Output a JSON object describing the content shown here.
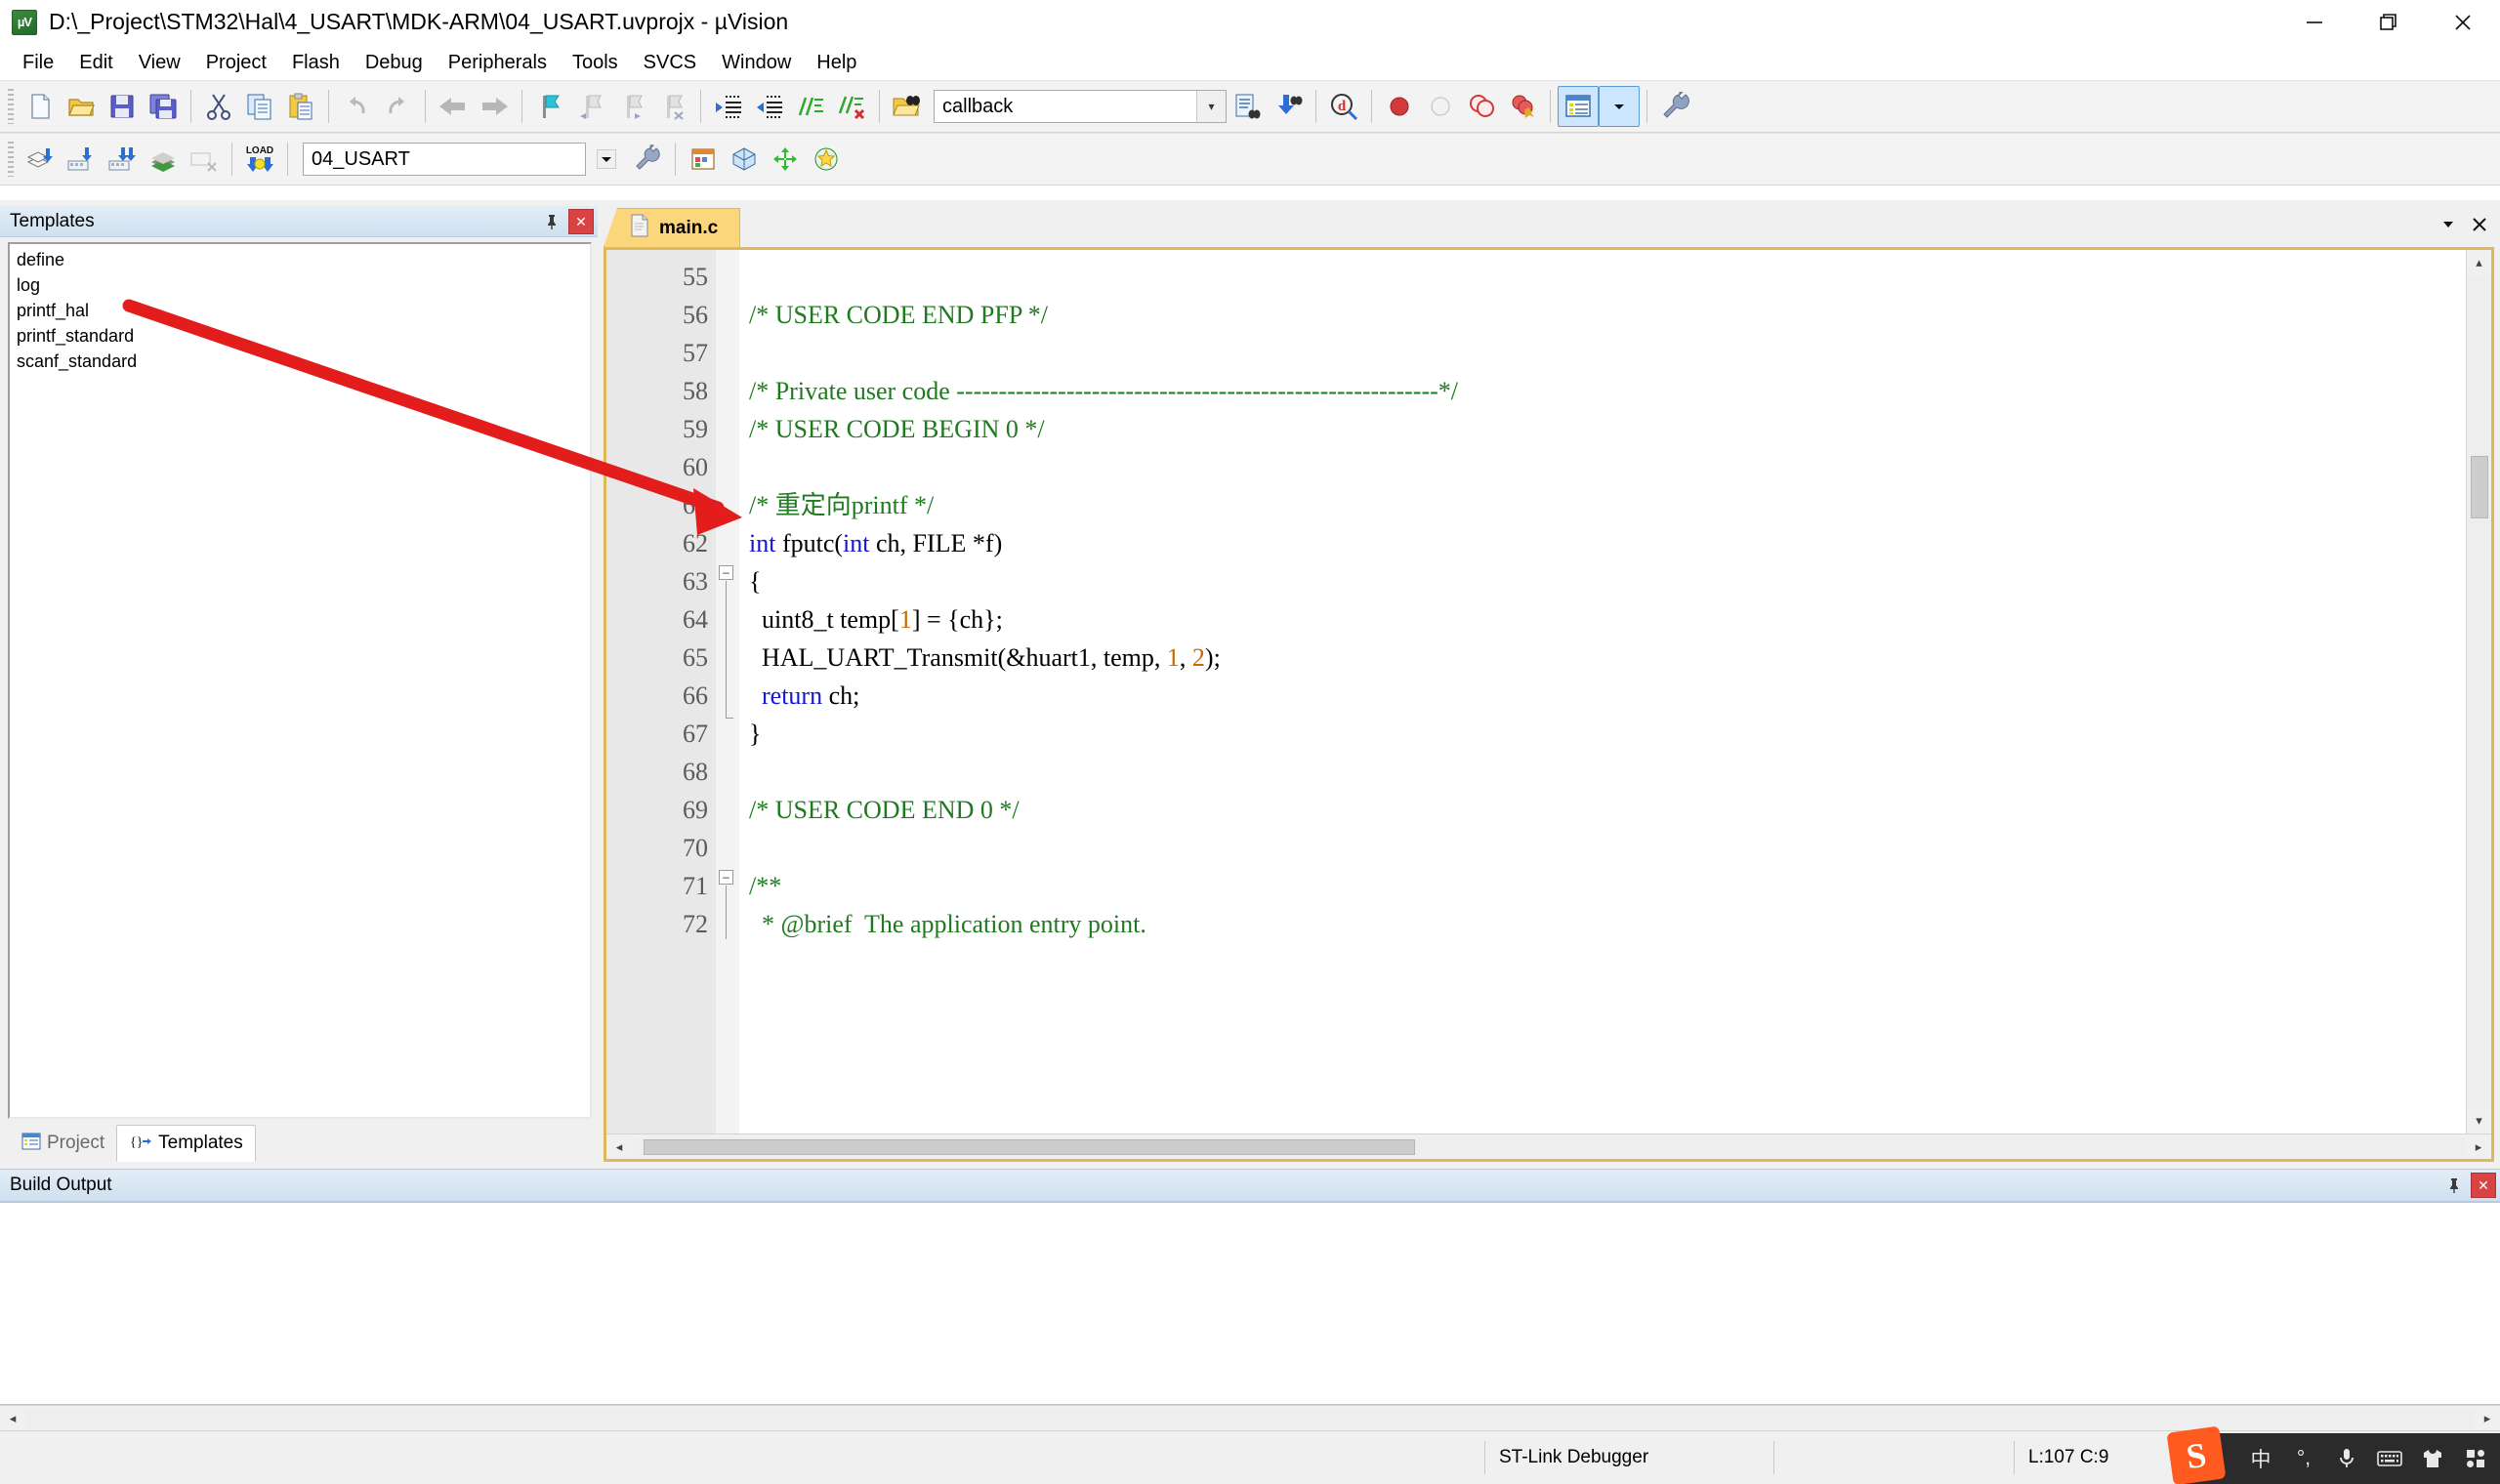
{
  "window": {
    "title": "D:\\_Project\\STM32\\Hal\\4_USART\\MDK-ARM\\04_USART.uvprojx - µVision",
    "app_icon": "uvision-icon",
    "controls": {
      "minimize": "minimize-icon",
      "maximize": "maximize-icon",
      "close": "close-icon"
    }
  },
  "menu": {
    "items": [
      {
        "label": "File"
      },
      {
        "label": "Edit"
      },
      {
        "label": "View"
      },
      {
        "label": "Project"
      },
      {
        "label": "Flash"
      },
      {
        "label": "Debug"
      },
      {
        "label": "Peripherals"
      },
      {
        "label": "Tools"
      },
      {
        "label": "SVCS"
      },
      {
        "label": "Window"
      },
      {
        "label": "Help"
      }
    ]
  },
  "toolbar_main": {
    "search_value": "callback",
    "search_placeholder": "",
    "buttons": [
      {
        "name": "new-file-icon"
      },
      {
        "name": "open-file-icon"
      },
      {
        "name": "save-icon"
      },
      {
        "name": "save-all-icon"
      },
      {
        "name": "cut-icon"
      },
      {
        "name": "copy-icon"
      },
      {
        "name": "paste-icon"
      },
      {
        "name": "undo-icon"
      },
      {
        "name": "redo-icon"
      },
      {
        "name": "navigate-back-icon"
      },
      {
        "name": "navigate-forward-icon"
      },
      {
        "name": "bookmark-toggle-icon"
      },
      {
        "name": "bookmark-prev-icon"
      },
      {
        "name": "bookmark-next-icon"
      },
      {
        "name": "bookmark-clear-icon"
      },
      {
        "name": "indent-right-icon"
      },
      {
        "name": "indent-left-icon"
      },
      {
        "name": "comment-icon"
      },
      {
        "name": "uncomment-icon"
      },
      {
        "name": "find-in-files-icon"
      }
    ]
  },
  "toolbar_build": {
    "project_value": "04_USART",
    "buttons": [
      {
        "name": "translate-icon"
      },
      {
        "name": "build-icon"
      },
      {
        "name": "rebuild-icon"
      },
      {
        "name": "batch-build-icon"
      },
      {
        "name": "stop-build-icon"
      },
      {
        "name": "download-load-icon"
      },
      {
        "name": "target-options-icon"
      },
      {
        "name": "manage-components-icon"
      },
      {
        "name": "pack-installer-icon"
      },
      {
        "name": "manage-run-time-icon"
      },
      {
        "name": "configuration-wizard-icon"
      }
    ]
  },
  "templates_panel": {
    "title": "Templates",
    "pin_icon": "pin-icon",
    "close_icon": "close-icon",
    "items": [
      {
        "label": "define"
      },
      {
        "label": "log"
      },
      {
        "label": "printf_hal"
      },
      {
        "label": "printf_standard"
      },
      {
        "label": "scanf_standard"
      }
    ],
    "tabs": [
      {
        "label": "Project",
        "icon": "project-icon",
        "active": false
      },
      {
        "label": "Templates",
        "icon": "templates-icon",
        "active": true
      }
    ]
  },
  "editor": {
    "tabs": [
      {
        "label": "main.c",
        "icon": "c-file-icon",
        "active": true
      }
    ],
    "tab_menu_icon": "chevron-down-icon",
    "tab_close_icon": "close-icon",
    "first_line": 55,
    "lines": [
      {
        "n": 55,
        "fold": "",
        "tokens": []
      },
      {
        "n": 56,
        "fold": "",
        "tokens": [
          {
            "t": "/* USER CODE END PFP */",
            "c": "cmt"
          }
        ]
      },
      {
        "n": 57,
        "fold": "",
        "tokens": []
      },
      {
        "n": 58,
        "fold": "",
        "tokens": [
          {
            "t": "/* Private user code ---------------------------------------------------------*/",
            "c": "cmt"
          }
        ]
      },
      {
        "n": 59,
        "fold": "",
        "tokens": [
          {
            "t": "/* USER CODE BEGIN 0 */",
            "c": "cmt"
          }
        ]
      },
      {
        "n": 60,
        "fold": "",
        "tokens": []
      },
      {
        "n": 61,
        "fold": "",
        "tokens": [
          {
            "t": "/* 重定向printf */",
            "c": "cmt"
          }
        ]
      },
      {
        "n": 62,
        "fold": "",
        "tokens": [
          {
            "t": "int",
            "c": "kw"
          },
          {
            "t": " fputc(",
            "c": ""
          },
          {
            "t": "int",
            "c": "kw"
          },
          {
            "t": " ch, FILE *f)",
            "c": ""
          }
        ]
      },
      {
        "n": 63,
        "fold": "start",
        "tokens": [
          {
            "t": "{",
            "c": ""
          }
        ]
      },
      {
        "n": 64,
        "fold": "mid",
        "tokens": [
          {
            "t": "  uint8_t temp[",
            "c": ""
          },
          {
            "t": "1",
            "c": "num"
          },
          {
            "t": "] = {ch};",
            "c": ""
          }
        ]
      },
      {
        "n": 65,
        "fold": "mid",
        "tokens": [
          {
            "t": "  HAL_UART_Transmit(&huart1, temp, ",
            "c": ""
          },
          {
            "t": "1",
            "c": "num"
          },
          {
            "t": ", ",
            "c": ""
          },
          {
            "t": "2",
            "c": "num"
          },
          {
            "t": ");",
            "c": ""
          }
        ]
      },
      {
        "n": 66,
        "fold": "mid",
        "tokens": [
          {
            "t": "  ",
            "c": ""
          },
          {
            "t": "return",
            "c": "kw"
          },
          {
            "t": " ch;",
            "c": ""
          }
        ]
      },
      {
        "n": 67,
        "fold": "end",
        "tokens": [
          {
            "t": "}",
            "c": ""
          }
        ]
      },
      {
        "n": 68,
        "fold": "",
        "tokens": []
      },
      {
        "n": 69,
        "fold": "",
        "tokens": [
          {
            "t": "/* USER CODE END 0 */",
            "c": "cmt"
          }
        ]
      },
      {
        "n": 70,
        "fold": "",
        "tokens": []
      },
      {
        "n": 71,
        "fold": "start",
        "tokens": [
          {
            "t": "/**",
            "c": "cmt"
          }
        ]
      },
      {
        "n": 72,
        "fold": "mid",
        "tokens": [
          {
            "t": "  * @brief  The application entry point.",
            "c": "cmt"
          }
        ]
      }
    ]
  },
  "build_output": {
    "title": "Build Output",
    "pin_icon": "pin-icon",
    "close_icon": "close-icon",
    "content": ""
  },
  "statusbar": {
    "debugger": "ST-Link Debugger",
    "middle": "",
    "cursor": "L:107 C:9"
  },
  "tray": {
    "sogou_logo": "S",
    "icons": [
      {
        "name": "ime-chinese-icon",
        "glyph": "中"
      },
      {
        "name": "ime-punctuation-icon",
        "glyph": "°,"
      },
      {
        "name": "microphone-icon",
        "glyph": "mic"
      },
      {
        "name": "keyboard-icon",
        "glyph": "kbd"
      },
      {
        "name": "skin-icon",
        "glyph": "skin"
      },
      {
        "name": "toolbox-icon",
        "glyph": "grid"
      }
    ]
  },
  "colors": {
    "tab_accent": "#fcd67b",
    "comment": "#1f7a1f",
    "keyword": "#1515d6",
    "number": "#cc6600",
    "annotation_arrow": "#e31c1c"
  }
}
